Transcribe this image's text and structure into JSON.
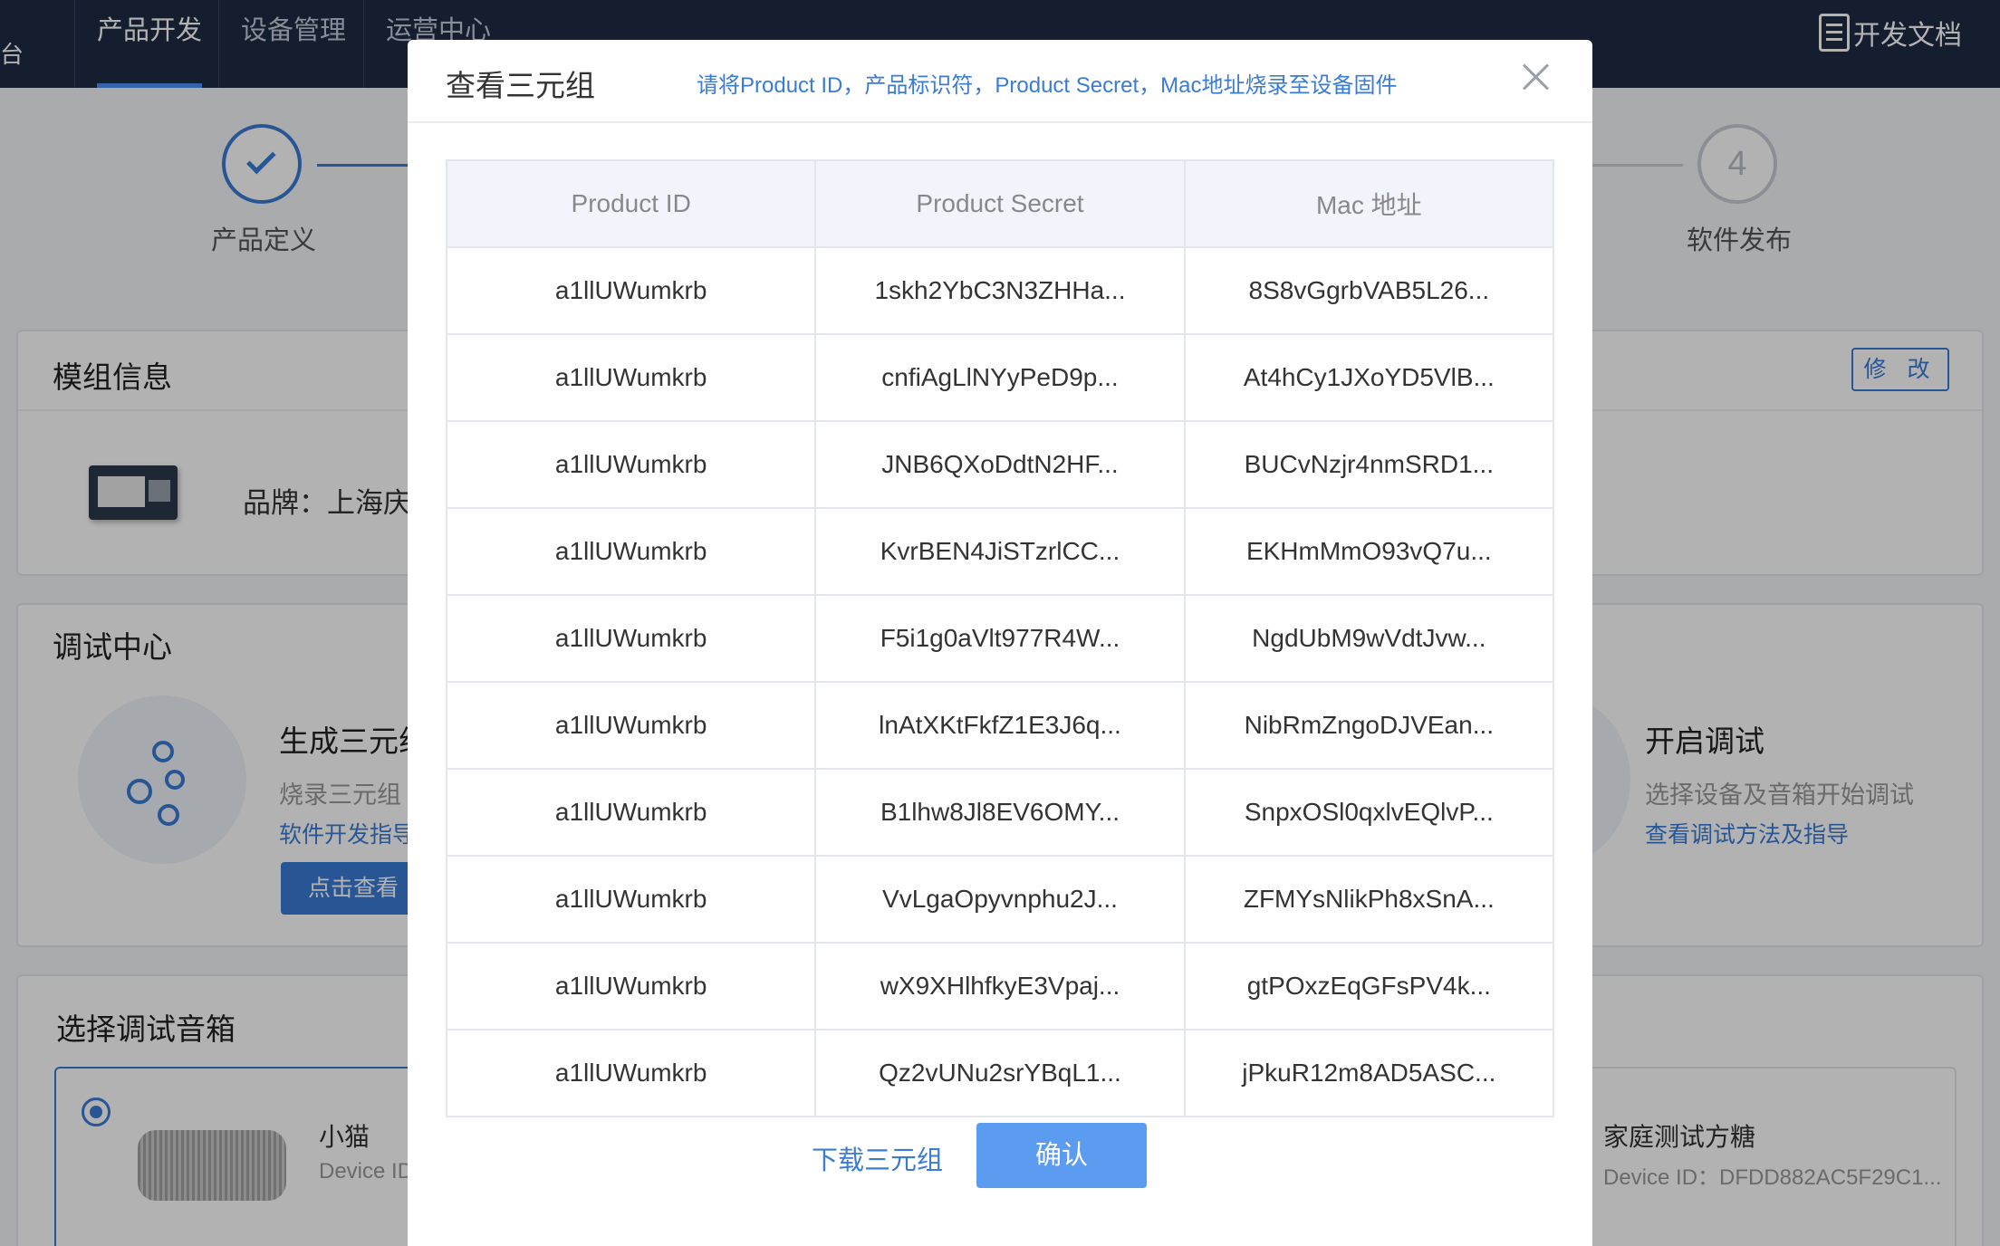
{
  "nav": {
    "brand_tail": "台",
    "tabs": [
      "产品开发",
      "设备管理",
      "运营中心"
    ],
    "docs_label": "开发文档"
  },
  "steps": {
    "step1_label": "产品定义",
    "step4_number": "4",
    "step4_label": "软件发布"
  },
  "module_card": {
    "title": "模组信息",
    "edit_label": "修 改",
    "brand_text": "品牌：上海庆ネ"
  },
  "debug_card": {
    "title": "调试中心",
    "gen_title": "生成三元组",
    "gen_desc": "烧录三元组",
    "gen_link": "软件开发指导",
    "gen_button": "点击查看",
    "open_title": "开启调试",
    "open_desc": "选择设备及音箱开始调试",
    "open_link": "查看调试方法及指导"
  },
  "speaker_card": {
    "title": "选择调试音箱",
    "left_name": "小猫",
    "left_id": "Device ID",
    "right_name": "家庭测试方糖",
    "right_id": "Device ID：DFDD882AC5F29C1..."
  },
  "modal": {
    "title": "查看三元组",
    "hint": "请将Product ID，产品标识符，Product Secret，Mac地址烧录至设备固件",
    "columns": [
      "Product ID",
      "Product Secret",
      "Mac 地址"
    ],
    "rows": [
      [
        "a1llUWumkrb",
        "1skh2YbC3N3ZHHa...",
        "8S8vGgrbVAB5L26..."
      ],
      [
        "a1llUWumkrb",
        "cnfiAgLlNYyPeD9p...",
        "At4hCy1JXoYD5VlB..."
      ],
      [
        "a1llUWumkrb",
        "JNB6QXoDdtN2HF...",
        "BUCvNzjr4nmSRD1..."
      ],
      [
        "a1llUWumkrb",
        "KvrBEN4JiSTzrlCC...",
        "EKHmMmO93vQ7u..."
      ],
      [
        "a1llUWumkrb",
        "F5i1g0aVlt977R4W...",
        "NgdUbM9wVdtJvw..."
      ],
      [
        "a1llUWumkrb",
        "lnAtXKtFkfZ1E3J6q...",
        "NibRmZngoDJVEan..."
      ],
      [
        "a1llUWumkrb",
        "B1lhw8Jl8EV6OMY...",
        "SnpxOSl0qxlvEQlvP..."
      ],
      [
        "a1llUWumkrb",
        "VvLgaOpyvnphu2J...",
        "ZFMYsNlikPh8xSnA..."
      ],
      [
        "a1llUWumkrb",
        "wX9XHlhfkyE3Vpaj...",
        "gtPOxzEqGFsPV4k..."
      ],
      [
        "a1llUWumkrb",
        "Qz2vUNu2srYBqL1...",
        "jPkuR12m8AD5ASC..."
      ]
    ],
    "download_label": "下载三元组",
    "confirm_label": "确认"
  }
}
